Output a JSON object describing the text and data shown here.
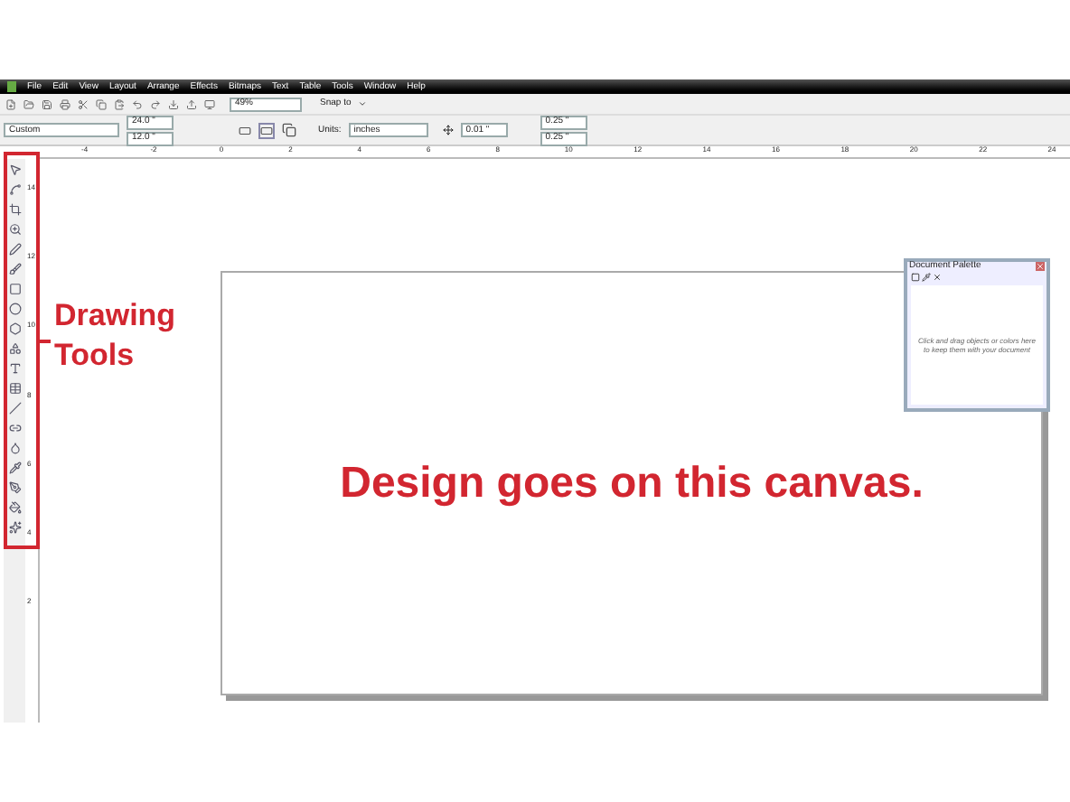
{
  "menu_bar": [
    "File",
    "Edit",
    "View",
    "Layout",
    "Arrange",
    "Effects",
    "Bitmaps",
    "Text",
    "Table",
    "Tools",
    "Window",
    "Help"
  ],
  "standard_toolbar": {
    "zoom": "49%",
    "snap": "Snap to"
  },
  "property_bar": {
    "preset": "Custom",
    "width": "24.0 \"",
    "height": "12.0 \"",
    "units_label": "Units:",
    "units": "inches",
    "nudge": "0.01 \"",
    "duplicate_x": "0.25 \"",
    "duplicate_y": "0.25 \""
  },
  "horizontal_ruler": [
    "-4",
    "-2",
    "0",
    "2",
    "4",
    "6",
    "8",
    "10",
    "12",
    "14",
    "16",
    "18",
    "20",
    "22",
    "24"
  ],
  "vertical_ruler": [
    "14",
    "12",
    "10",
    "8",
    "6",
    "4",
    "2"
  ],
  "document_palette": {
    "title": "Document Palette",
    "hint": "Click and drag objects or colors here to keep them with your document"
  },
  "annotations": {
    "toolbox_label": "Drawing Tools",
    "canvas_label": "Design goes on this canvas."
  }
}
